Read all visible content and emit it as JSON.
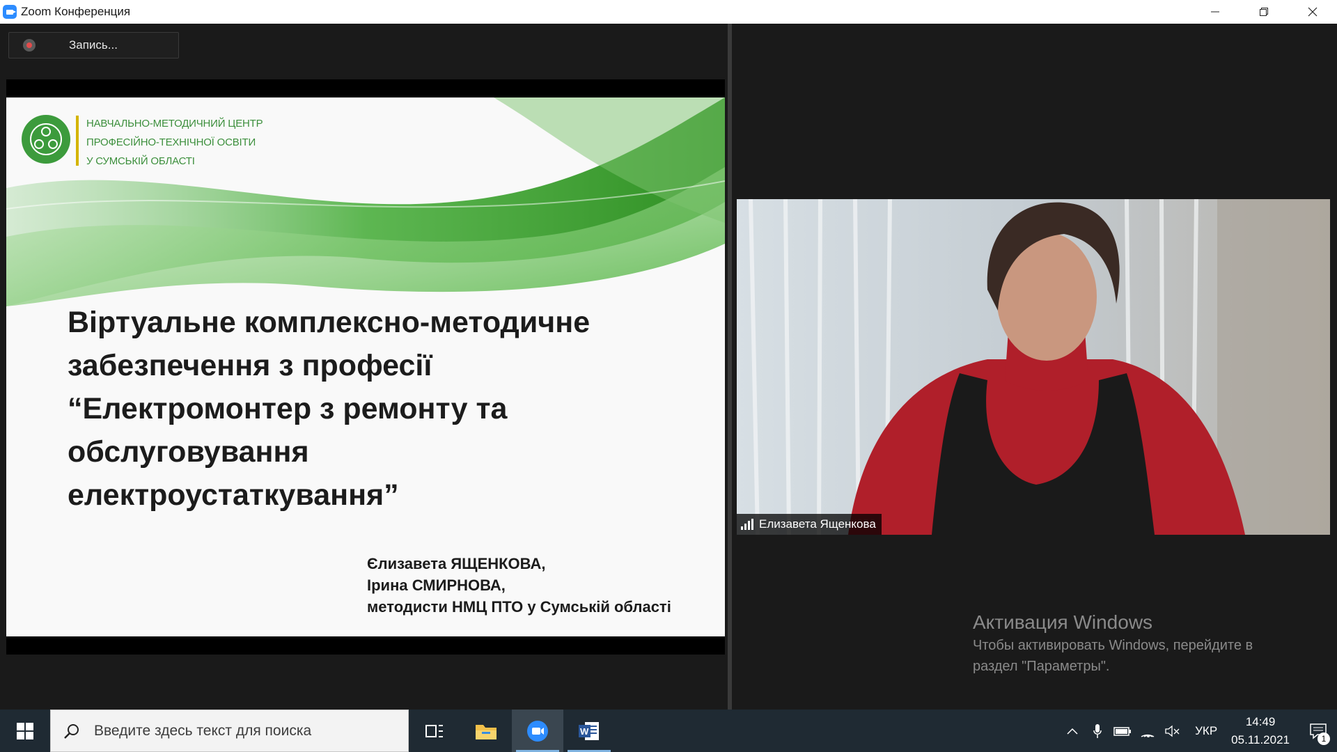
{
  "window": {
    "title": "Zoom Конференция",
    "minimize": "—",
    "restore": "❐",
    "close": "✕"
  },
  "recording": {
    "label": "Запись..."
  },
  "slide": {
    "org_lines": [
      "НАВЧАЛЬНО-МЕТОДИЧНИЙ ЦЕНТР",
      "ПРОФЕСІЙНО-ТЕХНІЧНОЇ ОСВІТИ",
      "У СУМСЬКІЙ ОБЛАСТІ"
    ],
    "title_lines": [
      "Віртуальне комплексно-методичне",
      "забезпечення з професії",
      "“Електромонтер з ремонту та",
      "обслуговування",
      "електроустаткування”"
    ],
    "author_lines": [
      "Єлизавета ЯЩЕНКОВА,",
      "Ірина СМИРНОВА,",
      "методисти НМЦ ПТО у Сумській області"
    ],
    "accent_color": "#3c9b3c"
  },
  "participant": {
    "name": "Елизавета Ященкова"
  },
  "activation": {
    "title": "Активация Windows",
    "line1": "Чтобы активировать Windows, перейдите в",
    "line2": "раздел \"Параметры\"."
  },
  "taskbar": {
    "search_placeholder": "Введите здесь текст для поиска",
    "language": "УКР",
    "time": "14:49",
    "date": "05.11.2021",
    "notification_count": "1"
  }
}
